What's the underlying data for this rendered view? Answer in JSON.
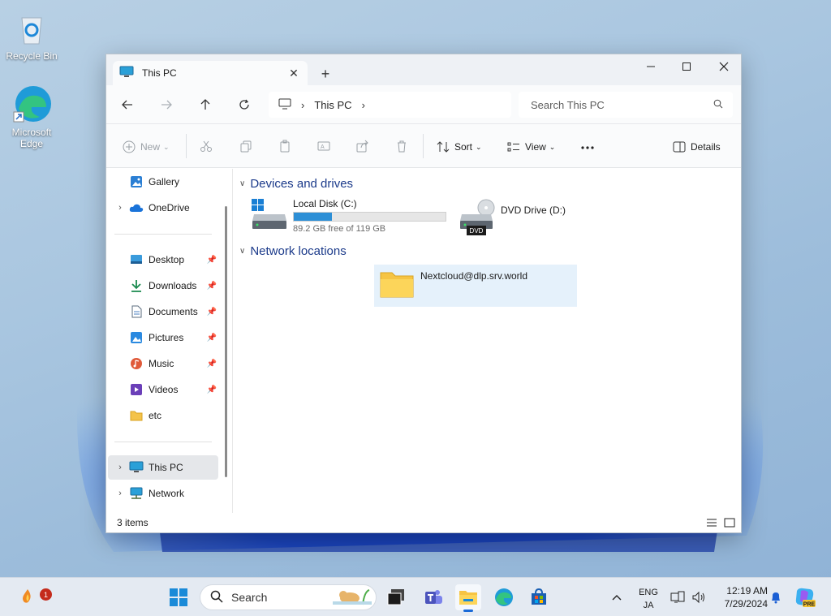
{
  "desktop": {
    "icons": [
      {
        "label": "Recycle Bin"
      },
      {
        "label": "Microsoft Edge"
      }
    ]
  },
  "window": {
    "tab_title": "This PC",
    "address": {
      "crumb": "This PC"
    },
    "search_placeholder": "Search This PC",
    "toolbar": {
      "new_label": "New",
      "sort_label": "Sort",
      "view_label": "View",
      "details_label": "Details"
    },
    "nav": {
      "gallery": "Gallery",
      "onedrive": "OneDrive",
      "quick": [
        "Desktop",
        "Downloads",
        "Documents",
        "Pictures",
        "Music",
        "Videos",
        "etc"
      ],
      "thispc": "This PC",
      "network": "Network"
    },
    "groups": {
      "devices": "Devices and drives",
      "network": "Network locations"
    },
    "drives": [
      {
        "name": "Local Disk (C:)",
        "free": "89.2 GB free of 119 GB",
        "used_fraction": 0.25
      },
      {
        "name": "DVD Drive (D:)",
        "badge": "DVD"
      }
    ],
    "network_item": "Nextcloud@dlp.srv.world",
    "status": "3 items"
  },
  "taskbar": {
    "search_label": "Search",
    "notification_count": "1",
    "lang": "ENG",
    "ime": "JA",
    "time": "12:19 AM",
    "date": "7/29/2024",
    "copilot_badge": "PRE"
  }
}
